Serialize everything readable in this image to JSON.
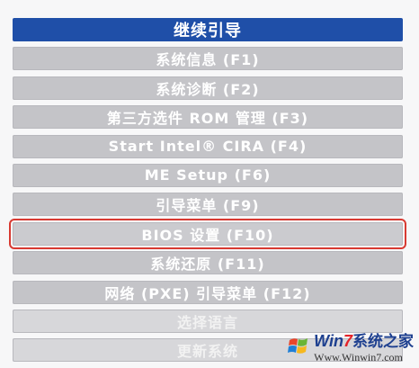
{
  "menu": {
    "items": [
      {
        "label": "继续引导",
        "state": "selected"
      },
      {
        "label": "系统信息 (F1)",
        "state": "normal"
      },
      {
        "label": "系统诊断 (F2)",
        "state": "normal"
      },
      {
        "label": "第三方选件 ROM 管理 (F3)",
        "state": "normal"
      },
      {
        "label": "Start Intel® CIRA (F4)",
        "state": "normal"
      },
      {
        "label": "ME Setup (F6)",
        "state": "normal"
      },
      {
        "label": "引导菜单 (F9)",
        "state": "normal"
      },
      {
        "label": "BIOS 设置 (F10)",
        "state": "highlighted"
      },
      {
        "label": "系统还原 (F11)",
        "state": "normal"
      },
      {
        "label": "网络 (PXE) 引导菜单 (F12)",
        "state": "normal"
      },
      {
        "label": "选择语言",
        "state": "faded"
      },
      {
        "label": "更新系统",
        "state": "faded"
      }
    ]
  },
  "colors": {
    "selected_bg": "#1f4fa8",
    "item_bg": "#c4c4c8",
    "highlight_border": "#d83a32"
  },
  "watermark": {
    "brand_prefix": "Win",
    "brand_digit": "7",
    "brand_cn": "系统之家",
    "url": "Www.Winwin7.com",
    "icon": "windows-logo-icon"
  }
}
